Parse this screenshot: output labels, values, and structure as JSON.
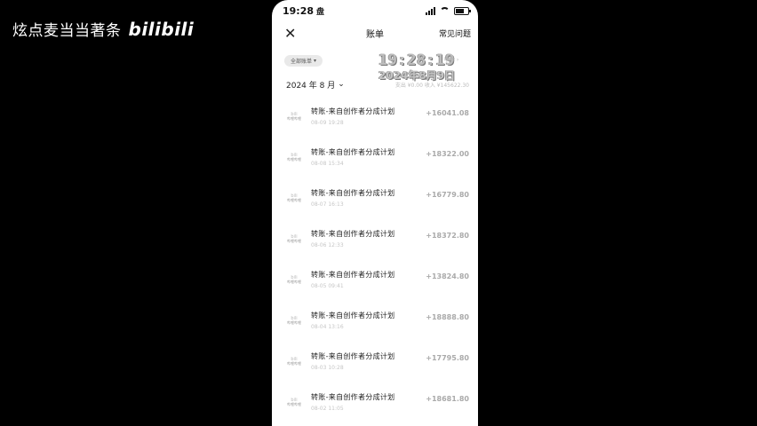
{
  "watermark": {
    "text": "炫点麦当当著条",
    "logo": "bilibili"
  },
  "status": {
    "time": "19:28",
    "badge": "盘"
  },
  "nav": {
    "close": "✕",
    "title": "账单",
    "faq": "常见问题"
  },
  "filter": {
    "label": "全部账单",
    "caret": "▾"
  },
  "overlay": {
    "time": "19:28:19",
    "tag": "收付 ›",
    "date": "2024年8月9日"
  },
  "month": {
    "label": "2024 年 8 月",
    "caret": "⌄",
    "summary": "支出 ¥0.00 收入 ¥145622.30"
  },
  "transactions": [
    {
      "avatar_top": "bili",
      "avatar_bottom": "哔哩哔哩",
      "title": "转账-来自创作者分成计划",
      "date": "08-09 19:28",
      "amount": "+16041.08"
    },
    {
      "avatar_top": "bili",
      "avatar_bottom": "哔哩哔哩",
      "title": "转账-来自创作者分成计划",
      "date": "08-08 15:34",
      "amount": "+18322.00"
    },
    {
      "avatar_top": "bili",
      "avatar_bottom": "哔哩哔哩",
      "title": "转账-来自创作者分成计划",
      "date": "08-07 16:13",
      "amount": "+16779.80"
    },
    {
      "avatar_top": "bili",
      "avatar_bottom": "哔哩哔哩",
      "title": "转账-来自创作者分成计划",
      "date": "08-06 12:33",
      "amount": "+18372.80"
    },
    {
      "avatar_top": "bili",
      "avatar_bottom": "哔哩哔哩",
      "title": "转账-来自创作者分成计划",
      "date": "08-05 09:41",
      "amount": "+13824.80"
    },
    {
      "avatar_top": "bili",
      "avatar_bottom": "哔哩哔哩",
      "title": "转账-来自创作者分成计划",
      "date": "08-04 13:16",
      "amount": "+18888.80"
    },
    {
      "avatar_top": "bili",
      "avatar_bottom": "哔哩哔哩",
      "title": "转账-来自创作者分成计划",
      "date": "08-03 10:28",
      "amount": "+17795.80"
    },
    {
      "avatar_top": "bili",
      "avatar_bottom": "哔哩哔哩",
      "title": "转账-来自创作者分成计划",
      "date": "08-02 11:05",
      "amount": "+18681.80"
    }
  ]
}
